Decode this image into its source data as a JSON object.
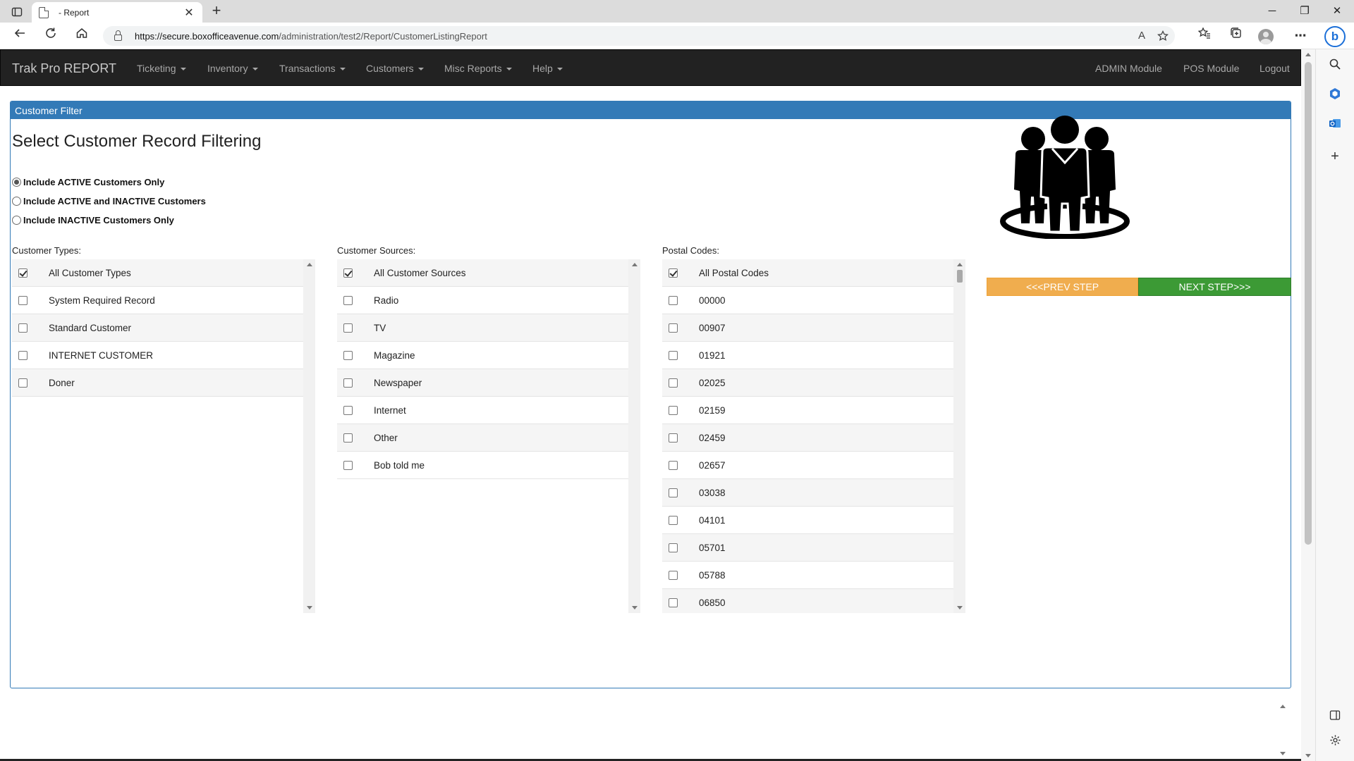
{
  "browser": {
    "tab_title": "- Report",
    "tab_close": "✕",
    "new_tab": "+",
    "url_host": "https://secure.boxofficeavenue.com",
    "url_path": "/administration/test2/Report/CustomerListingReport",
    "win_minimize": "─",
    "win_restore": "❐",
    "win_close": "✕",
    "bing_label": "b",
    "read_aloud": "A",
    "more_menu": "⋯"
  },
  "navbar": {
    "brand": "Trak Pro REPORT",
    "menus": [
      "Ticketing",
      "Inventory",
      "Transactions",
      "Customers",
      "Misc Reports",
      "Help"
    ],
    "right_links": [
      "ADMIN Module",
      "POS Module",
      "Logout"
    ]
  },
  "panel": {
    "heading": "Customer Filter",
    "title": "Select Customer Record Filtering",
    "status_options": [
      {
        "label": "Include ACTIVE Customers Only",
        "checked": true
      },
      {
        "label": "Include ACTIVE and INACTIVE Customers",
        "checked": false
      },
      {
        "label": "Include INACTIVE Customers Only",
        "checked": false
      }
    ],
    "customer_types": {
      "label": "Customer Types:",
      "items": [
        "All Customer Types",
        "System Required Record",
        "Standard Customer",
        "INTERNET CUSTOMER",
        "Doner"
      ],
      "checked": [
        true,
        false,
        false,
        false,
        false
      ]
    },
    "customer_sources": {
      "label": "Customer Sources:",
      "items": [
        "All Customer Sources",
        "Radio",
        "TV",
        "Magazine",
        "Newspaper",
        "Internet",
        "Other",
        "Bob told me"
      ],
      "checked": [
        true,
        false,
        false,
        false,
        false,
        false,
        false,
        false
      ]
    },
    "postal_codes": {
      "label": "Postal Codes:",
      "items": [
        "All Postal Codes",
        "00000",
        "00907",
        "01921",
        "02025",
        "02159",
        "02459",
        "02657",
        "03038",
        "04101",
        "05701",
        "05788",
        "06850"
      ],
      "checked": [
        true,
        false,
        false,
        false,
        false,
        false,
        false,
        false,
        false,
        false,
        false,
        false,
        false
      ]
    },
    "prev_button": "<<<PREV STEP",
    "next_button": "NEXT STEP>>>"
  },
  "colors": {
    "panel_primary": "#337ab7",
    "navbar_bg": "#222222",
    "prev_button": "#f0ad4e",
    "next_button": "#3c9a35"
  },
  "icons": [
    "sidebar-toggle-icon",
    "page-icon",
    "back-icon",
    "refresh-icon",
    "home-icon",
    "lock-icon",
    "read-aloud-icon",
    "favorite-add-icon",
    "favorites-icon",
    "collections-icon",
    "profile-icon",
    "more-icon",
    "bing-icon",
    "search-icon",
    "office-icon",
    "outlook-icon",
    "add-icon",
    "split-screen-icon",
    "settings-icon",
    "group-people-icon"
  ]
}
